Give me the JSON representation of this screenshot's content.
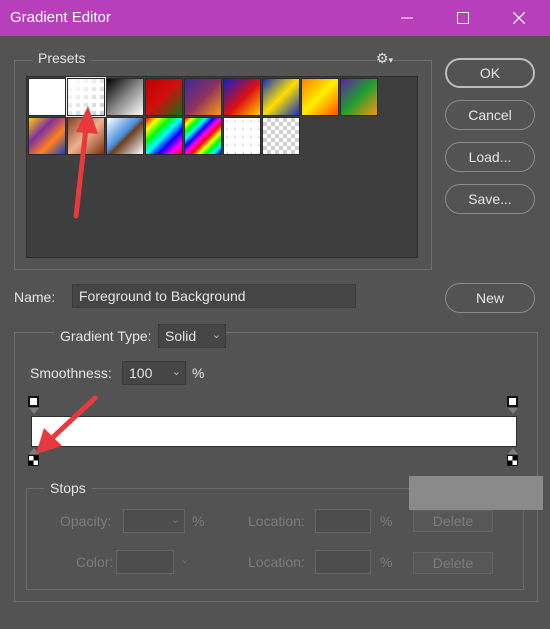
{
  "window": {
    "title": "Gradient Editor",
    "minimize_icon": "minimize-icon",
    "maximize_icon": "maximize-icon",
    "close_icon": "close-icon"
  },
  "presets": {
    "legend": "Presets",
    "settings_icon": "gear-icon",
    "swatches": [
      {
        "name": "foreground-to-background",
        "style": "linear-gradient(#fff,#fff)"
      },
      {
        "name": "foreground-to-transparent",
        "style": "checker-fade"
      },
      {
        "name": "black-white",
        "style": "linear-gradient(135deg,#000 0%,#888 50%,#fff 100%)"
      },
      {
        "name": "red-green",
        "style": "linear-gradient(135deg,#c00000 0%,#d01010 50%,#107010 100%)"
      },
      {
        "name": "violet-orange",
        "style": "linear-gradient(135deg,#3a2a9a 0%,#8a3060 50%,#ff9a10 100%)"
      },
      {
        "name": "blue-red-yellow",
        "style": "linear-gradient(135deg,#1020d0 0%,#e01010 55%,#ffd000 100%)"
      },
      {
        "name": "blue-yellow-blue",
        "style": "linear-gradient(135deg,#1030c0 0%,#ffe000 50%,#1030c0 100%)"
      },
      {
        "name": "orange-yellow-orange",
        "style": "linear-gradient(135deg,#ff8000 0%,#ffee00 50%,#ff5000 100%)"
      },
      {
        "name": "violet-green-orange",
        "style": "linear-gradient(135deg,#6020a0 0%,#20a030 50%,#ff9010 100%)"
      },
      {
        "name": "yellow-violet-orange-blue",
        "style": "linear-gradient(135deg,#ffd000 0%,#8030a0 35%,#ff8020 65%,#1040c0 100%)"
      },
      {
        "name": "copper",
        "style": "linear-gradient(135deg,#8a3c20 0%,#f0b090 50%,#7a3010 100%)"
      },
      {
        "name": "chrome",
        "style": "linear-gradient(135deg,#ffffff 0%,#4a90e0 45%,#6a4020 55%,#ffffff 100%)"
      },
      {
        "name": "spectrum",
        "style": "linear-gradient(135deg,#ff0000,#ffff00,#00ff00,#00ffff,#0000ff,#ff00ff,#ff0000)"
      },
      {
        "name": "transparent-rainbow",
        "style": "repeating-linear-gradient(135deg,#ff0000 0px,#ffff00 5px,#00ff00 10px,#00ffff 15px,#0000ff 20px,#ff00ff 25px,#ff0000 30px)"
      },
      {
        "name": "transparent-stripes",
        "style": "checker-stripes"
      },
      {
        "name": "neutral-density",
        "style": "checker"
      }
    ]
  },
  "buttons": {
    "ok": "OK",
    "cancel": "Cancel",
    "load": "Load...",
    "save": "Save...",
    "new": "New"
  },
  "name_field": {
    "label": "Name:",
    "value": "Foreground to Background"
  },
  "gradient": {
    "type_label": "Gradient Type:",
    "type_value": "Solid",
    "smoothness_label": "Smoothness:",
    "smoothness_value": "100",
    "smoothness_unit": "%",
    "colors": [
      "#ffffff",
      "#ffffff"
    ]
  },
  "stops": {
    "legend": "Stops",
    "opacity_label": "Opacity:",
    "opacity_unit": "%",
    "location_label": "Location:",
    "location_unit": "%",
    "color_label": "Color:",
    "delete_label": "Delete"
  },
  "annotations": {
    "arrow_color": "#e8393f"
  }
}
